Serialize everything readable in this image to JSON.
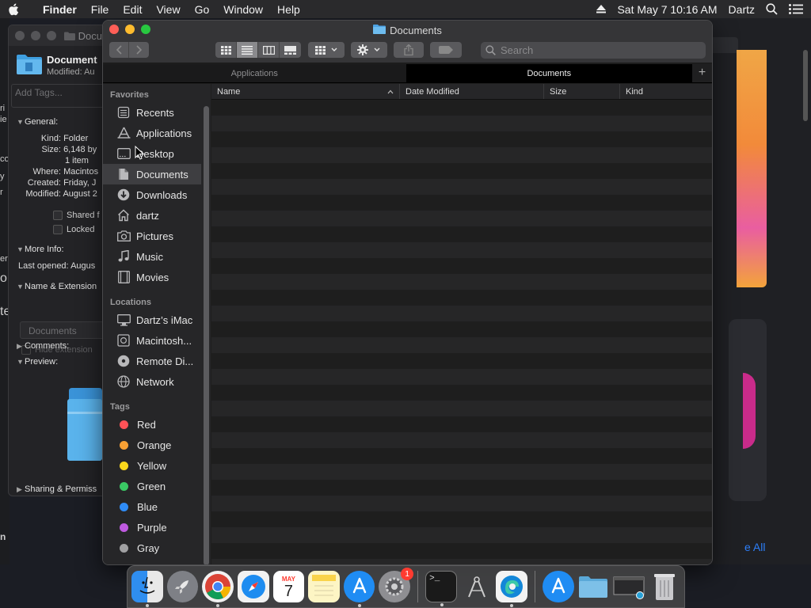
{
  "menubar": {
    "app_name": "Finder",
    "items": [
      "File",
      "Edit",
      "View",
      "Go",
      "Window",
      "Help"
    ],
    "clock": "Sat May 7  10:16 AM",
    "user": "Dartz"
  },
  "info_window": {
    "title": "Docu",
    "name": "Document",
    "modified_header": "Modified: Au",
    "tags_placeholder": "Add Tags...",
    "general_label": "General:",
    "kind_label": "Kind:",
    "kind_value": "Folder",
    "size_label": "Size:",
    "size_value": "6,148 by",
    "size_items": "1 item",
    "where_label": "Where:",
    "where_value": "Macintos",
    "created_label": "Created:",
    "created_value": "Friday, J",
    "modified_label": "Modified:",
    "modified_value": "August 2",
    "shared_label": "Shared f",
    "locked_label": "Locked",
    "more_info_label": "More Info:",
    "last_opened_label": "Last opened:",
    "last_opened_value": "Augus",
    "name_ext_label": "Name & Extension",
    "name_value": "Documents",
    "hide_ext_label": "Hide extension",
    "comments_label": "Comments:",
    "preview_label": "Preview:",
    "sharing_label": "Sharing & Permiss"
  },
  "left_sliver": [
    "ri",
    "ie",
    "co",
    "y",
    "r",
    "er",
    "o",
    "te",
    "n"
  ],
  "finder": {
    "title": "Documents",
    "search_placeholder": "Search",
    "tabs": [
      "Applications",
      "Documents"
    ],
    "plus": "+",
    "sidebar": {
      "favorites_label": "Favorites",
      "favorites": [
        {
          "label": "Recents",
          "icon": "recents-icon"
        },
        {
          "label": "Applications",
          "icon": "applications-icon"
        },
        {
          "label": "Desktop",
          "icon": "desktop-icon"
        },
        {
          "label": "Documents",
          "icon": "documents-icon",
          "selected": true
        },
        {
          "label": "Downloads",
          "icon": "downloads-icon"
        },
        {
          "label": "dartz",
          "icon": "home-icon"
        },
        {
          "label": "Pictures",
          "icon": "pictures-icon"
        },
        {
          "label": "Music",
          "icon": "music-icon"
        },
        {
          "label": "Movies",
          "icon": "movies-icon"
        }
      ],
      "locations_label": "Locations",
      "locations": [
        {
          "label": "Dartz’s iMac",
          "icon": "imac-icon"
        },
        {
          "label": "Macintosh...",
          "icon": "disk-icon"
        },
        {
          "label": "Remote Di...",
          "icon": "remote-disc-icon"
        },
        {
          "label": "Network",
          "icon": "network-icon"
        }
      ],
      "tags_label": "Tags",
      "tags": [
        {
          "label": "Red",
          "color": "#ff5257"
        },
        {
          "label": "Orange",
          "color": "#f7a034"
        },
        {
          "label": "Yellow",
          "color": "#f9d71c"
        },
        {
          "label": "Green",
          "color": "#3ac864"
        },
        {
          "label": "Blue",
          "color": "#2f8cf6"
        },
        {
          "label": "Purple",
          "color": "#bf5ae0"
        },
        {
          "label": "Gray",
          "color": "#a0a0a2"
        }
      ]
    },
    "columns": [
      "Name",
      "Date Modified",
      "Size",
      "Kind"
    ]
  },
  "bg_app": {
    "see_all": "e All"
  },
  "dock": {
    "calendar_month": "MAY",
    "calendar_day": "7",
    "settings_badge": "1",
    "terminal_prompt": ">_"
  }
}
